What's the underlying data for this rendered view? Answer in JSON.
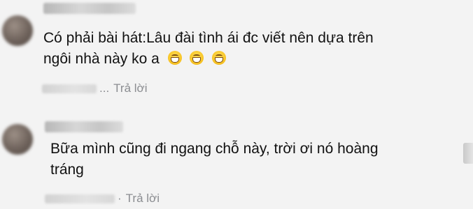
{
  "comments": [
    {
      "text_line1": "Có phải bài hát:Lâu đài tình ái đc viết nên dựa trên",
      "text_line2": "ngôi nhà này ko a",
      "emoji_count": 3,
      "emoji_icon": "grinning-face-icon",
      "meta_ellipsis": "...",
      "reply_label": "Trả lời"
    },
    {
      "text_line1": "Bữa mình cũng đi ngang chỗ này, trời ơi nó hoàng",
      "text_line2": "tráng",
      "meta_ellipsis": "·",
      "reply_label": "Trả lời"
    }
  ]
}
